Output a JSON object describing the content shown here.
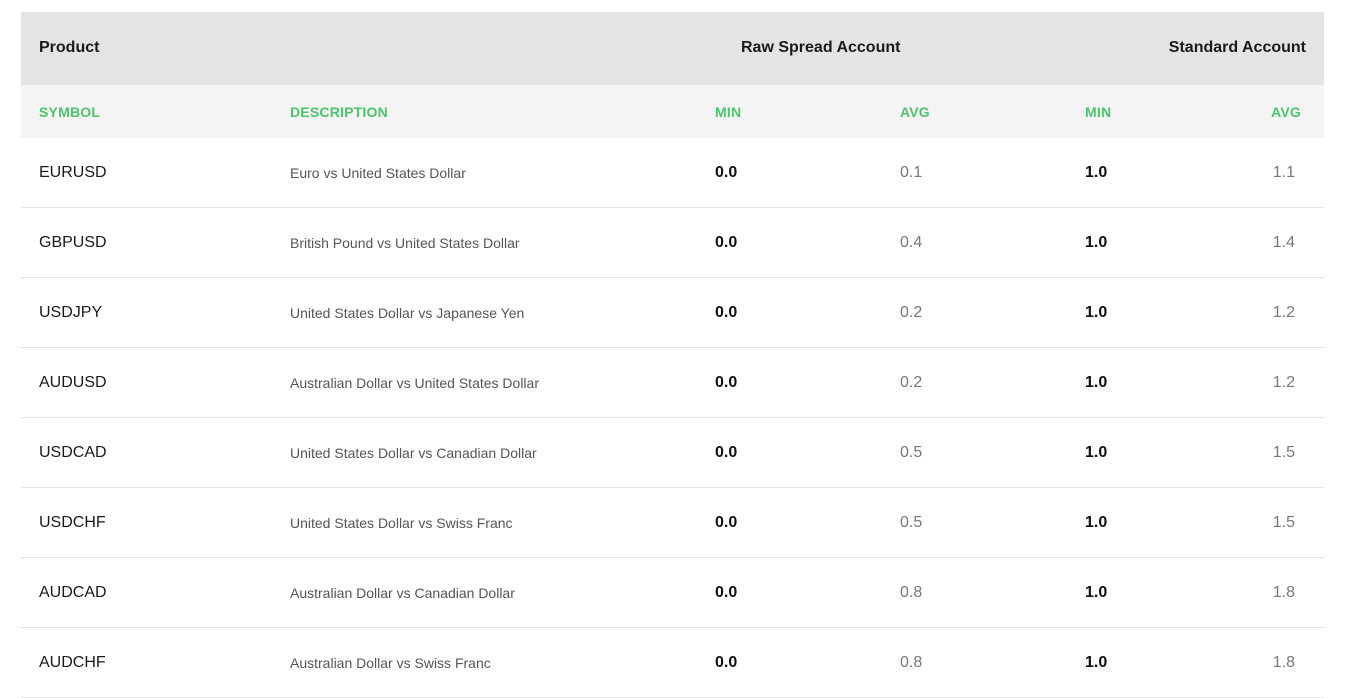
{
  "header": {
    "product": "Product",
    "raw_spread_account": "Raw Spread Account",
    "standard_account": "Standard Account"
  },
  "columns": {
    "symbol": "SYMBOL",
    "description": "DESCRIPTION",
    "raw_min": "MIN",
    "raw_avg": "AVG",
    "standard_min": "MIN",
    "standard_avg": "AVG"
  },
  "colors": {
    "accent_green": "#4cc46b",
    "header_bg": "#e3e4e4",
    "subheader_bg": "#f4f4f4"
  },
  "rows": [
    {
      "symbol": "EURUSD",
      "description": "Euro vs United States Dollar",
      "raw_min": "0.0",
      "raw_avg": "0.1",
      "standard_min": "1.0",
      "standard_avg": "1.1"
    },
    {
      "symbol": "GBPUSD",
      "description": "British Pound vs United States Dollar",
      "raw_min": "0.0",
      "raw_avg": "0.4",
      "standard_min": "1.0",
      "standard_avg": "1.4"
    },
    {
      "symbol": "USDJPY",
      "description": "United States Dollar vs Japanese Yen",
      "raw_min": "0.0",
      "raw_avg": "0.2",
      "standard_min": "1.0",
      "standard_avg": "1.2"
    },
    {
      "symbol": "AUDUSD",
      "description": "Australian Dollar vs United States Dollar",
      "raw_min": "0.0",
      "raw_avg": "0.2",
      "standard_min": "1.0",
      "standard_avg": "1.2"
    },
    {
      "symbol": "USDCAD",
      "description": "United States Dollar vs Canadian Dollar",
      "raw_min": "0.0",
      "raw_avg": "0.5",
      "standard_min": "1.0",
      "standard_avg": "1.5"
    },
    {
      "symbol": "USDCHF",
      "description": "United States Dollar vs Swiss Franc",
      "raw_min": "0.0",
      "raw_avg": "0.5",
      "standard_min": "1.0",
      "standard_avg": "1.5"
    },
    {
      "symbol": "AUDCAD",
      "description": "Australian Dollar vs Canadian Dollar",
      "raw_min": "0.0",
      "raw_avg": "0.8",
      "standard_min": "1.0",
      "standard_avg": "1.8"
    },
    {
      "symbol": "AUDCHF",
      "description": "Australian Dollar vs Swiss Franc",
      "raw_min": "0.0",
      "raw_avg": "0.8",
      "standard_min": "1.0",
      "standard_avg": "1.8"
    }
  ]
}
